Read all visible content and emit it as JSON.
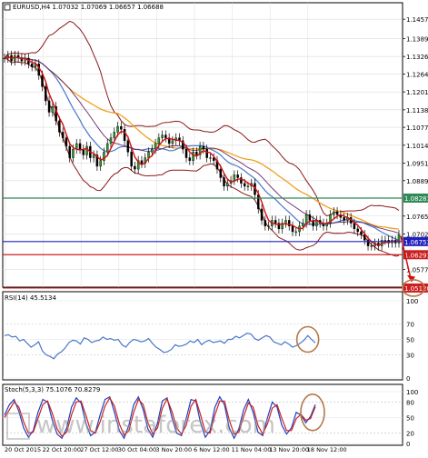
{
  "chart_data": [
    {
      "type": "candlestick",
      "panel": "price",
      "title": "EURUSD,H4  1.07032 1.07069 1.06657 1.06688",
      "ylim": [
        1.0515,
        1.1515
      ],
      "y_ticks": [
        1.1457,
        1.1389,
        1.1326,
        1.12645,
        1.12015,
        1.11385,
        1.1077,
        1.1014,
        1.0951,
        1.08895,
        1.0765,
        1.0702,
        1.05775
      ],
      "y_tick_labels": [
        "1.14570",
        "1.13890",
        "1.13260",
        "1.12645",
        "1.12015",
        "1.11385",
        "1.10770",
        "1.10140",
        "1.09510",
        "1.08895",
        "1.07650",
        "1.07020",
        "1.05775"
      ],
      "x_tick_labels": [
        "20 Oct 2015",
        "22 Oct 20:00",
        "27 Oct 12:00",
        "30 Oct 04:00",
        "3 Nov 20:00",
        "6 Nov 12:00",
        "11 Nov 04:00",
        "13 Nov 20:00",
        "18 Nov 12:00"
      ],
      "close_series": [
        1.132,
        1.133,
        1.131,
        1.133,
        1.132,
        1.131,
        1.132,
        1.13,
        1.129,
        1.13,
        1.126,
        1.122,
        1.117,
        1.113,
        1.115,
        1.11,
        1.106,
        1.104,
        1.101,
        1.097,
        1.1,
        1.102,
        1.1,
        1.098,
        1.101,
        1.097,
        1.098,
        1.094,
        1.096,
        1.099,
        1.102,
        1.104,
        1.106,
        1.108,
        1.107,
        1.103,
        1.099,
        1.094,
        1.093,
        1.096,
        1.095,
        1.097,
        1.099,
        1.1,
        1.102,
        1.104,
        1.105,
        1.104,
        1.102,
        1.103,
        1.104,
        1.103,
        1.1,
        1.097,
        1.096,
        1.099,
        1.098,
        1.101,
        1.1,
        1.097,
        1.097,
        1.096,
        1.093,
        1.09,
        1.087,
        1.088,
        1.089,
        1.091,
        1.09,
        1.088,
        1.087,
        1.087,
        1.088,
        1.084,
        1.079,
        1.075,
        1.073,
        1.073,
        1.075,
        1.074,
        1.072,
        1.074,
        1.075,
        1.073,
        1.071,
        1.071,
        1.073,
        1.074,
        1.077,
        1.075,
        1.073,
        1.075,
        1.074,
        1.073,
        1.074,
        1.077,
        1.078,
        1.077,
        1.076,
        1.075,
        1.076,
        1.074,
        1.072,
        1.071,
        1.07,
        1.068,
        1.066,
        1.066,
        1.067,
        1.066,
        1.068,
        1.068,
        1.067,
        1.068,
        1.067,
        1.07
      ],
      "horizontal_levels": [
        {
          "value": 1.08281,
          "label": "1.08281",
          "color": "#2e8b57"
        },
        {
          "value": 1.06753,
          "label": "1.06753",
          "color": "#1f1fbf"
        },
        {
          "value": 1.06291,
          "label": "1.06291",
          "color": "#cc1f1f"
        },
        {
          "value": 1.0512,
          "label": "1.05120",
          "color": "#cc1f1f"
        }
      ],
      "overlays": [
        "Bollinger Bands",
        "moving averages"
      ],
      "annotations": [
        "red arrow pointing down toward 1.05120",
        "brown ellipse around 1.05120 target"
      ],
      "grid": true
    },
    {
      "type": "line",
      "panel": "rsi",
      "title": "RSI(14) 45.5134",
      "ylim": [
        0,
        100
      ],
      "y_ticks": [
        100,
        70,
        50,
        30,
        0
      ],
      "y_tick_labels": [
        "100",
        "70",
        "50",
        "30",
        "0"
      ],
      "values": [
        55,
        56,
        53,
        54,
        48,
        50,
        45,
        40,
        43,
        47,
        35,
        30,
        28,
        25,
        31,
        34,
        39,
        46,
        49,
        48,
        44,
        52,
        50,
        46,
        48,
        49,
        53,
        50,
        51,
        49,
        50,
        43,
        40,
        46,
        50,
        49,
        47,
        48,
        51,
        45,
        40,
        37,
        33,
        34,
        37,
        43,
        41,
        42,
        44,
        48,
        46,
        50,
        43,
        47,
        49,
        46,
        47,
        48,
        45,
        50,
        50,
        54,
        52,
        55,
        58,
        57,
        51,
        49,
        52,
        55,
        53,
        47,
        45,
        43,
        47,
        44,
        40,
        42,
        45,
        49,
        55,
        50,
        45.5
      ],
      "annotations": [
        "brown ellipse around latest RSI values"
      ],
      "grid": true
    },
    {
      "type": "line",
      "panel": "stochastic",
      "title": "Stoch(5,3,3) 75.1076 70.8279",
      "ylim": [
        0,
        100
      ],
      "y_ticks": [
        100,
        80,
        50,
        20,
        0
      ],
      "y_tick_labels": [
        "100",
        "80",
        "50",
        "20",
        "0"
      ],
      "series": [
        {
          "values": [
            55,
            75,
            85,
            62,
            30,
            12,
            25,
            60,
            85,
            80,
            45,
            18,
            10,
            30,
            70,
            88,
            78,
            40,
            15,
            22,
            55,
            85,
            90,
            60,
            25,
            10,
            35,
            75,
            90,
            65,
            28,
            12,
            40,
            82,
            88,
            50,
            20,
            15,
            48,
            85,
            82,
            40,
            12,
            25,
            70,
            90,
            75,
            30,
            10,
            28,
            65,
            85,
            60,
            22,
            15,
            50,
            80,
            70,
            35,
            18,
            30,
            60,
            55,
            40,
            52,
            75.1
          ],
          "color": "#1f3fbf"
        },
        {
          "values": [
            50,
            65,
            80,
            70,
            42,
            20,
            22,
            48,
            75,
            82,
            58,
            28,
            14,
            22,
            55,
            80,
            82,
            55,
            25,
            20,
            42,
            72,
            88,
            72,
            38,
            16,
            25,
            60,
            85,
            75,
            40,
            18,
            30,
            68,
            86,
            62,
            30,
            18,
            35,
            72,
            85,
            55,
            22,
            20,
            55,
            82,
            82,
            45,
            18,
            22,
            52,
            78,
            70,
            35,
            18,
            38,
            68,
            75,
            48,
            25,
            25,
            48,
            56,
            45,
            48,
            70.8
          ],
          "color": "#cc1f1f"
        }
      ],
      "annotations": [
        "brown ellipse around latest stochastic values"
      ],
      "grid": true
    }
  ],
  "watermark": "www.instaforex.com"
}
